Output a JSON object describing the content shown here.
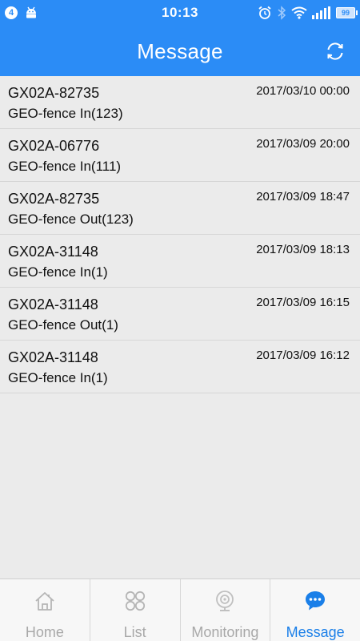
{
  "status_bar": {
    "notification_count": "4",
    "time": "10:13",
    "battery": "99",
    "icons": [
      "android-icon",
      "alarm-icon",
      "bluetooth-icon",
      "wifi-icon",
      "signal-icon",
      "battery-icon"
    ]
  },
  "header": {
    "title": "Message",
    "refresh_icon": "refresh-icon"
  },
  "messages": [
    {
      "device": "GX02A-82735",
      "event": "GEO-fence In(123)",
      "time": "2017/03/10 00:00"
    },
    {
      "device": "GX02A-06776",
      "event": "GEO-fence In(111)",
      "time": "2017/03/09 20:00"
    },
    {
      "device": "GX02A-82735",
      "event": "GEO-fence Out(123)",
      "time": "2017/03/09 18:47"
    },
    {
      "device": "GX02A-31148",
      "event": "GEO-fence In(1)",
      "time": "2017/03/09 18:13"
    },
    {
      "device": "GX02A-31148",
      "event": "GEO-fence Out(1)",
      "time": "2017/03/09 16:15"
    },
    {
      "device": "GX02A-31148",
      "event": "GEO-fence In(1)",
      "time": "2017/03/09 16:12"
    }
  ],
  "tabs": [
    {
      "label": "Home",
      "icon": "home-icon",
      "active": false
    },
    {
      "label": "List",
      "icon": "grid-icon",
      "active": false
    },
    {
      "label": "Monitoring",
      "icon": "camera-icon",
      "active": false
    },
    {
      "label": "Message",
      "icon": "chat-bubble-icon",
      "active": true
    }
  ],
  "colors": {
    "primary": "#2b8cf6",
    "active_tab": "#1a7fe8",
    "inactive_tab": "#a8a8a8",
    "list_background": "#ebebeb"
  }
}
